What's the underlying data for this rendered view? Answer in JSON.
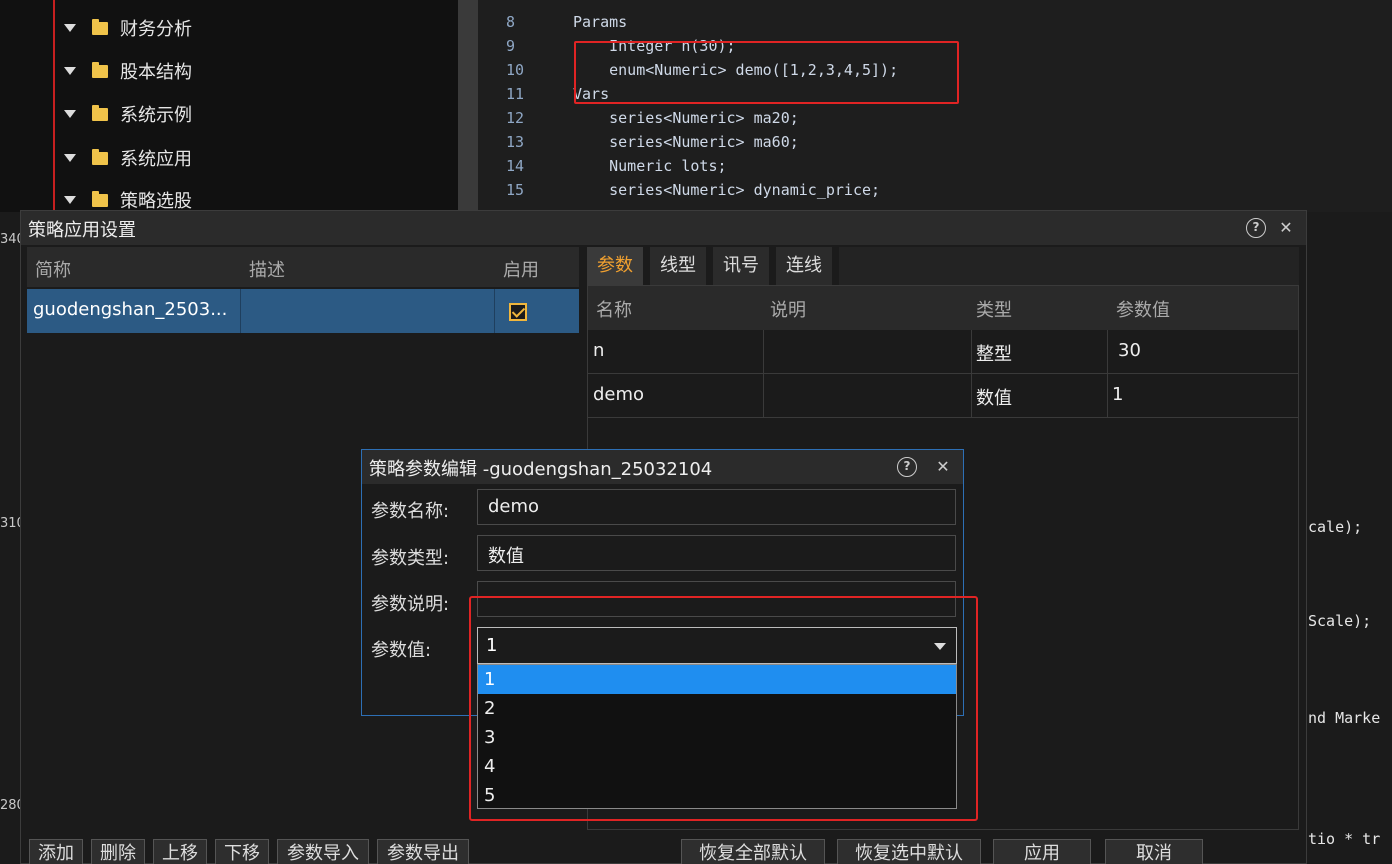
{
  "tree": {
    "items": [
      "财务分析",
      "股本结构",
      "系统示例",
      "系统应用",
      "策略选股"
    ]
  },
  "editor": {
    "lines": [
      {
        "num": "8",
        "text": "Params"
      },
      {
        "num": "9",
        "text": "    Integer n(30);"
      },
      {
        "num": "10",
        "text": "    enum<Numeric> demo([1,2,3,4,5]);"
      },
      {
        "num": "11",
        "text": "Vars"
      },
      {
        "num": "12",
        "text": "    series<Numeric> ma20;"
      },
      {
        "num": "13",
        "text": "    series<Numeric> ma60;"
      },
      {
        "num": "14",
        "text": "    Numeric lots;"
      },
      {
        "num": "15",
        "text": "    series<Numeric> dynamic_price;"
      }
    ],
    "right_fragments": [
      "cale);",
      "Scale);",
      "nd Marke",
      "tio * tr"
    ],
    "gutter_numbers": [
      "340",
      "310",
      "280"
    ]
  },
  "main_dialog": {
    "title": "策略应用设置",
    "list_headers": {
      "abbr": "简称",
      "desc": "描述",
      "enabled": "启用"
    },
    "list_rows": [
      {
        "abbr": "guodengshan_2503...",
        "desc": "",
        "enabled": true
      }
    ],
    "tabs": [
      "参数",
      "线型",
      "讯号",
      "连线"
    ],
    "active_tab": "参数",
    "param_headers": {
      "name": "名称",
      "note": "说明",
      "type": "类型",
      "value": "参数值"
    },
    "params": [
      {
        "name": "n",
        "note": "",
        "type": "整型",
        "value": "30"
      },
      {
        "name": "demo",
        "note": "",
        "type": "数值",
        "value": "1"
      }
    ],
    "buttons_left": [
      "添加",
      "删除",
      "上移",
      "下移",
      "参数导入",
      "参数导出"
    ],
    "buttons_right": [
      "恢复全部默认",
      "恢复选中默认",
      "应用",
      "取消"
    ]
  },
  "edit_dialog": {
    "title": "策略参数编辑  -guodengshan_25032104",
    "name_label": "参数名称:",
    "name_value": "demo",
    "type_label": "参数类型:",
    "type_value": "数值",
    "desc_label": "参数说明:",
    "desc_value": "",
    "value_label": "参数值:",
    "value_selected": "1",
    "options": [
      "1",
      "2",
      "3",
      "4",
      "5"
    ]
  },
  "colors": {
    "highlight_red": "#e02424",
    "selected_blue": "#1f8ef0",
    "active_tab_orange": "#f0a030",
    "row_select": "#2c5a84"
  }
}
